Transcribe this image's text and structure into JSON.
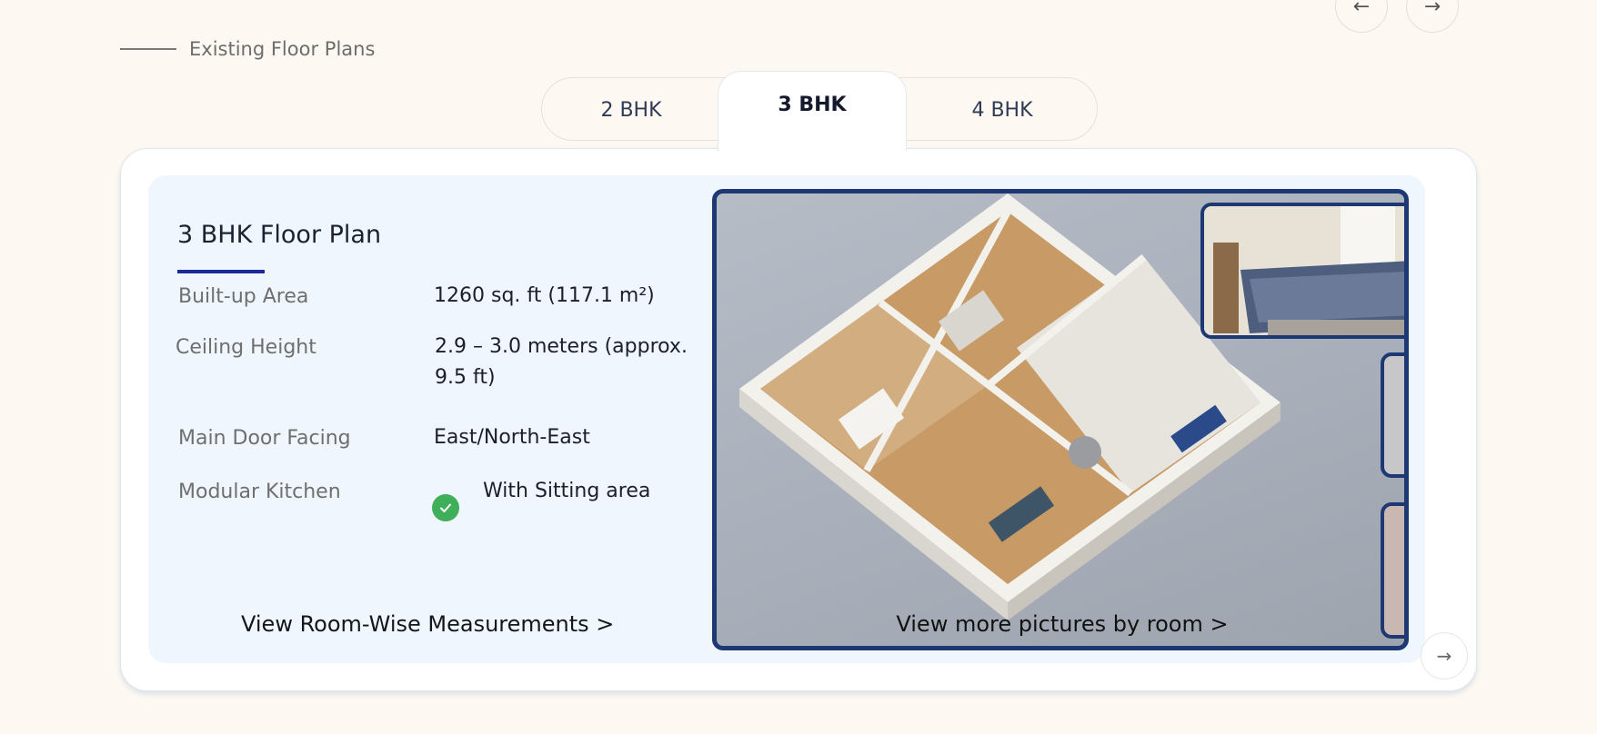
{
  "nav": {
    "prev_icon": "←",
    "next_icon": "→"
  },
  "section": {
    "title": "Existing Floor Plans"
  },
  "tabs": [
    {
      "label": "2 BHK",
      "active": false
    },
    {
      "label": "3 BHK",
      "active": true
    },
    {
      "label": "4 BHK",
      "active": false
    }
  ],
  "plan": {
    "title": "3 BHK Floor Plan",
    "specs": [
      {
        "label": "Built-up Area",
        "value": "1260 sq. ft (117.1 m²)"
      },
      {
        "label": "Ceiling Height",
        "value": "2.9 – 3.0 meters (approx.",
        "value_line2": "9.5 ft)"
      },
      {
        "label": "Main Door Facing",
        "value": "East/North-East"
      },
      {
        "label": "Modular Kitchen",
        "value": "With Sitting area",
        "icon": "check-icon"
      }
    ],
    "room_link": "View Room-Wise Measurements >"
  },
  "gallery": {
    "link": "View more pictures by room  >",
    "next_icon": "→"
  },
  "colors": {
    "background": "#fdf9f2",
    "accent": "#1f2a9a",
    "panel_border": "#1d3872",
    "check": "#3faf5a"
  }
}
